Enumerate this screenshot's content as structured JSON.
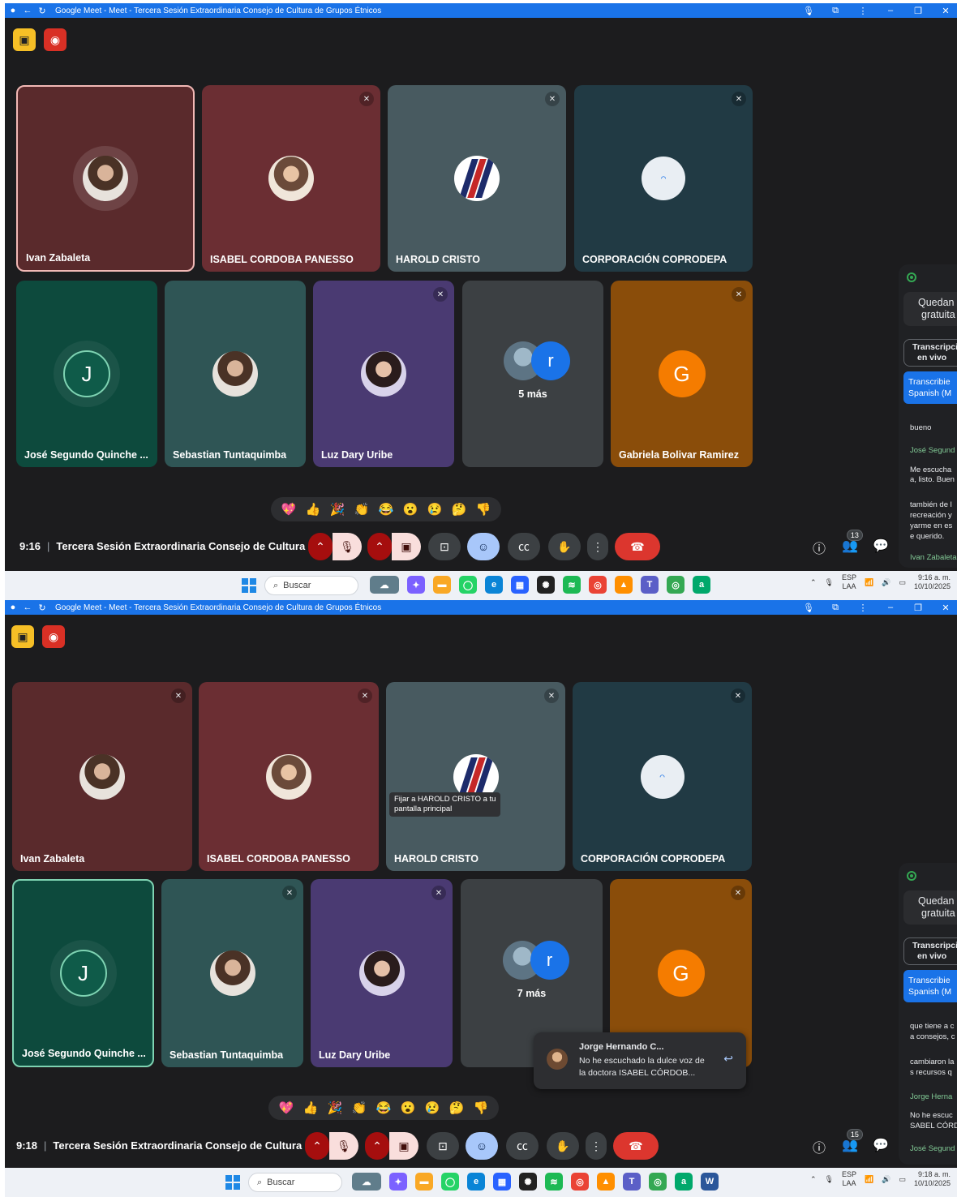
{
  "browser": {
    "title": "Google Meet - Meet - Tercera Sesión Extraordinaria Consejo de Cultura de Grupos Étnicos"
  },
  "taskbar": {
    "search_placeholder": "Buscar",
    "lang_line1": "ESP",
    "lang_line2": "LAA"
  },
  "screens": [
    {
      "participants": [
        {
          "name": "Ivan Zabaleta"
        },
        {
          "name": "ISABEL CORDOBA PANESSO"
        },
        {
          "name": "HAROLD CRISTO"
        },
        {
          "name": "CORPORACIÓN COPRODEPA"
        },
        {
          "name": "José Segundo Quinche ...",
          "initial": "J"
        },
        {
          "name": "Sebastian Tuntaquimba"
        },
        {
          "name": "Luz Dary Uribe"
        },
        {
          "more_initial": "r",
          "more_label": "5 más"
        },
        {
          "name": "Gabriela Bolivar Ramirez",
          "initial": "G"
        }
      ],
      "time": "9:16",
      "meeting_title": "Tercera Sesión Extraordinaria Consejo de Cultura ...",
      "people_count": "13",
      "clock_time": "9:16 a. m.",
      "clock_date": "10/10/2025",
      "side": {
        "remaining_1": "Quedan",
        "remaining_2": "gratuita",
        "transcription_1": "Transcripci",
        "transcription_2": "en vivo",
        "transcribing_1": "Transcribie",
        "transcribing_2": "Spanish (M",
        "lines": [
          {
            "kind": "text",
            "text": "bueno"
          },
          {
            "kind": "speaker",
            "text": "José Segund"
          },
          {
            "kind": "text",
            "text": "Me escucha"
          },
          {
            "kind": "text",
            "text": "a, listo. Buen"
          },
          {
            "kind": "text",
            "text": "también de l"
          },
          {
            "kind": "text",
            "text": "recreación y"
          },
          {
            "kind": "text",
            "text": "yarme en es"
          },
          {
            "kind": "text",
            "text": "e querido."
          },
          {
            "kind": "speaker",
            "text": "Ivan Zabaleta"
          }
        ]
      }
    },
    {
      "participants": [
        {
          "name": "Ivan Zabaleta"
        },
        {
          "name": "ISABEL CORDOBA PANESSO"
        },
        {
          "name": "HAROLD CRISTO"
        },
        {
          "name": "CORPORACIÓN COPRODEPA"
        },
        {
          "name": "José Segundo Quinche ...",
          "initial": "J"
        },
        {
          "name": "Sebastian Tuntaquimba"
        },
        {
          "name": "Luz Dary Uribe"
        },
        {
          "more_initial": "r",
          "more_label": "7 más"
        },
        {
          "name": "",
          "initial": "G"
        }
      ],
      "tooltip_1": "Fijar a HAROLD CRISTO a tu",
      "tooltip_2": "pantalla principal",
      "toast": {
        "name": "Jorge Hernando C...",
        "message": "No he escuchado la dulce voz de la doctora ISABEL CÓRDOB..."
      },
      "time": "9:18",
      "meeting_title": "Tercera Sesión Extraordinaria Consejo de Cultura ...",
      "people_count": "15",
      "clock_time": "9:18 a. m.",
      "clock_date": "10/10/2025",
      "side": {
        "remaining_1": "Quedan",
        "remaining_2": "gratuita",
        "transcription_1": "Transcripci",
        "transcription_2": "en vivo",
        "transcribing_1": "Transcribie",
        "transcribing_2": "Spanish (M",
        "lines": [
          {
            "kind": "text",
            "text": "que tiene a c"
          },
          {
            "kind": "text",
            "text": "a consejos, c"
          },
          {
            "kind": "text",
            "text": "cambiaron la"
          },
          {
            "kind": "text",
            "text": "s recursos q"
          },
          {
            "kind": "speaker",
            "text": "Jorge Herna"
          },
          {
            "kind": "text",
            "text": "No he escuc"
          },
          {
            "kind": "text",
            "text": "SABEL CÓRD"
          },
          {
            "kind": "speaker",
            "text": "José Segund"
          }
        ]
      }
    }
  ],
  "colors": {
    "meet_bg": "#1c1c1e",
    "titlebar": "#1a73e8",
    "hangup": "#dc362e",
    "active_border": "#7ed3b2"
  }
}
